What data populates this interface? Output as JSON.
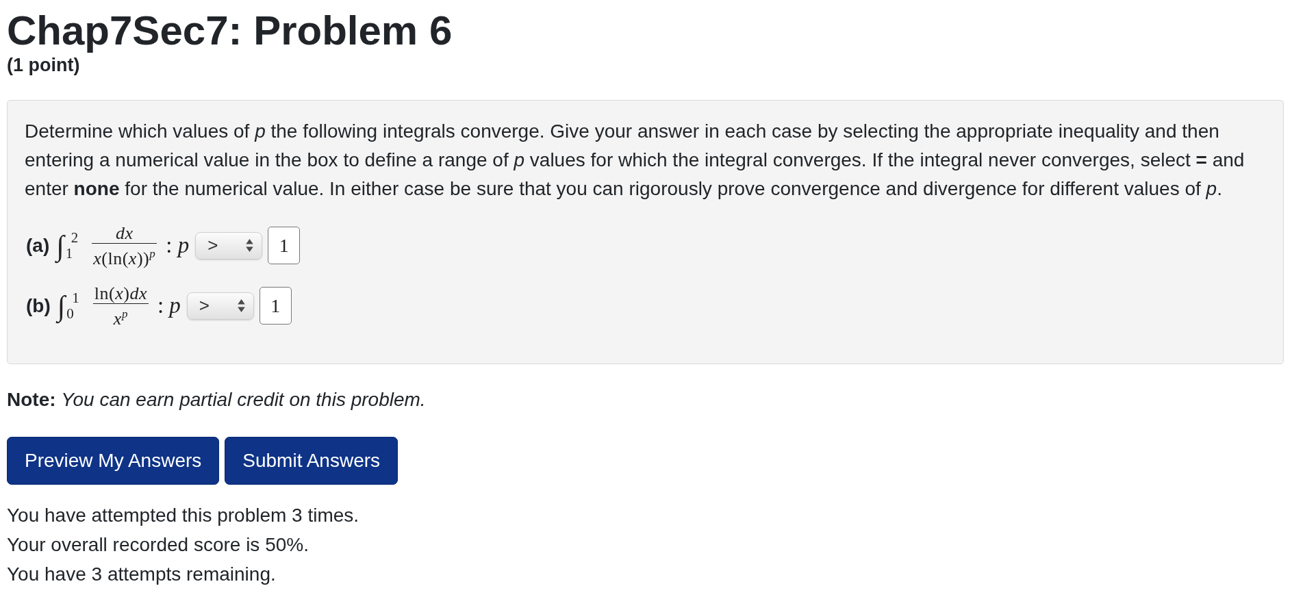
{
  "title": "Chap7Sec7: Problem 6",
  "points": "(1 point)",
  "problem": {
    "instructions": "Determine which values of *p* the following integrals converge. Give your answer in each case by selecting the appropriate inequality and then entering a numerical value in the box to define a range of *p* values for which the integral converges. If the integral never converges, select **=** and enter **none** for the numerical value. In either case be sure that you can rigorously prove convergence and divergence for different values of *p*.",
    "parts": [
      {
        "label": "(a)",
        "integral": {
          "sign": "∫",
          "lower": "1",
          "upper": "2",
          "numerator": "*dx*",
          "denominator": "*x*(ln(*x*))$^{p}$"
        },
        "relation": ": *p*",
        "inequality": {
          "value": ">"
        },
        "answer": {
          "value": "1"
        }
      },
      {
        "label": "(b)",
        "integral": {
          "sign": "∫",
          "lower": "0",
          "upper": "1",
          "numerator": "ln(*x*)*dx*",
          "denominator": "*x*$^{p}$"
        },
        "relation": ": *p*",
        "inequality": {
          "value": ">"
        },
        "answer": {
          "value": "1"
        }
      }
    ]
  },
  "note": "**Note:** *You can earn partial credit on this problem.*",
  "buttons": [
    "Preview My Answers",
    "Submit Answers"
  ],
  "status_lines": [
    "You have attempted this problem 3 times.",
    "Your overall recorded score is 50%.",
    "You have 3 attempts remaining."
  ]
}
